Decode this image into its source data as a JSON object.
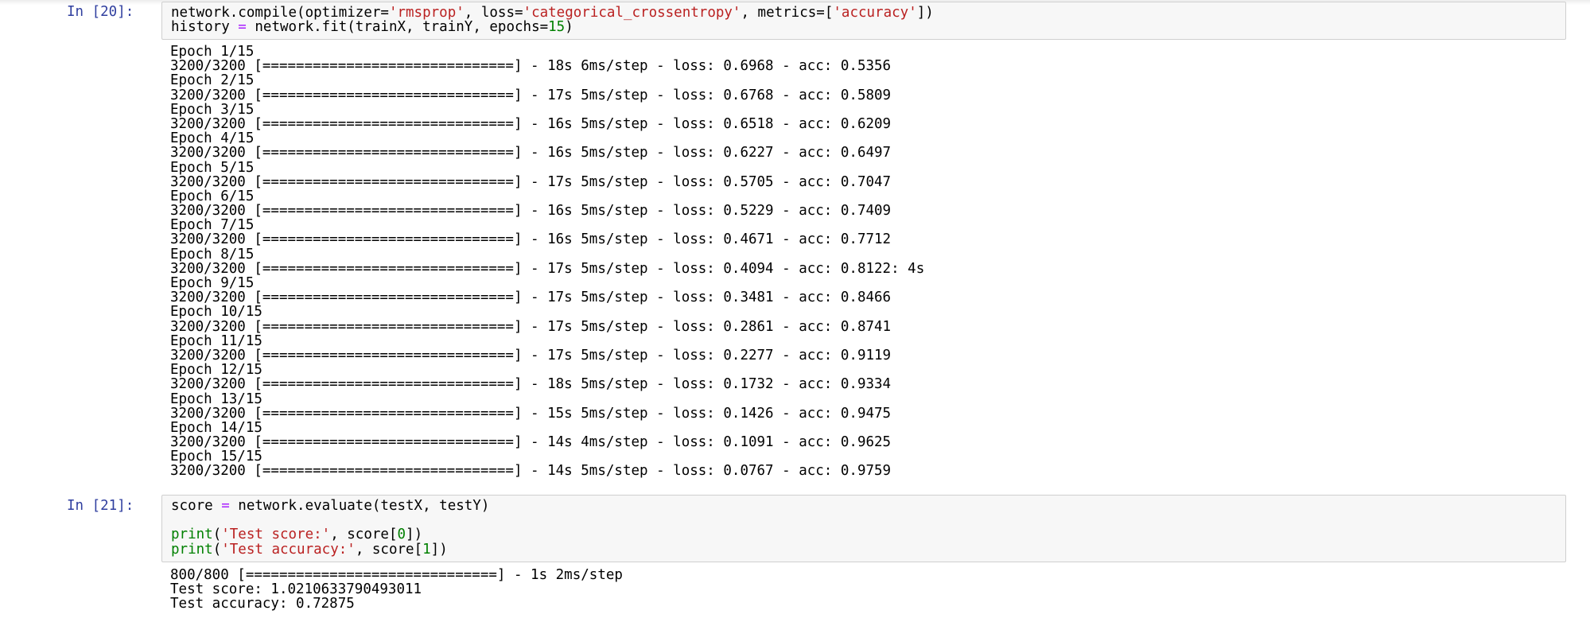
{
  "cells": [
    {
      "prompt": "In [20]:",
      "code": {
        "line1": {
          "a": "network.compile(optimizer=",
          "s1": "'rmsprop'",
          "b": ", loss=",
          "s2": "'categorical_crossentropy'",
          "c": ", metrics=[",
          "s3": "'accuracy'",
          "d": "])"
        },
        "line2": {
          "a": "history ",
          "op": "=",
          "b": " network.fit(trainX, trainY, epochs=",
          "n": "15",
          "c": ")"
        }
      },
      "output": [
        "Epoch 1/15",
        "3200/3200 [==============================] - 18s 6ms/step - loss: 0.6968 - acc: 0.5356",
        "Epoch 2/15",
        "3200/3200 [==============================] - 17s 5ms/step - loss: 0.6768 - acc: 0.5809",
        "Epoch 3/15",
        "3200/3200 [==============================] - 16s 5ms/step - loss: 0.6518 - acc: 0.6209",
        "Epoch 4/15",
        "3200/3200 [==============================] - 16s 5ms/step - loss: 0.6227 - acc: 0.6497",
        "Epoch 5/15",
        "3200/3200 [==============================] - 17s 5ms/step - loss: 0.5705 - acc: 0.7047",
        "Epoch 6/15",
        "3200/3200 [==============================] - 16s 5ms/step - loss: 0.5229 - acc: 0.7409",
        "Epoch 7/15",
        "3200/3200 [==============================] - 16s 5ms/step - loss: 0.4671 - acc: 0.7712",
        "Epoch 8/15",
        "3200/3200 [==============================] - 17s 5ms/step - loss: 0.4094 - acc: 0.8122: 4s",
        "Epoch 9/15",
        "3200/3200 [==============================] - 17s 5ms/step - loss: 0.3481 - acc: 0.8466",
        "Epoch 10/15",
        "3200/3200 [==============================] - 17s 5ms/step - loss: 0.2861 - acc: 0.8741",
        "Epoch 11/15",
        "3200/3200 [==============================] - 17s 5ms/step - loss: 0.2277 - acc: 0.9119",
        "Epoch 12/15",
        "3200/3200 [==============================] - 18s 5ms/step - loss: 0.1732 - acc: 0.9334",
        "Epoch 13/15",
        "3200/3200 [==============================] - 15s 5ms/step - loss: 0.1426 - acc: 0.9475",
        "Epoch 14/15",
        "3200/3200 [==============================] - 14s 4ms/step - loss: 0.1091 - acc: 0.9625",
        "Epoch 15/15",
        "3200/3200 [==============================] - 14s 5ms/step - loss: 0.0767 - acc: 0.9759"
      ]
    },
    {
      "prompt": "In [21]:",
      "code": {
        "line1": {
          "a": "score ",
          "op": "=",
          "b": " network.evaluate(testX, testY)"
        },
        "line3": {
          "kw": "print",
          "p1": "(",
          "s": "'Test score:'",
          "b": ", score[",
          "n": "0",
          "c": "])"
        },
        "line4": {
          "kw": "print",
          "p1": "(",
          "s": "'Test accuracy:'",
          "b": ", score[",
          "n": "1",
          "c": "])"
        }
      },
      "output": [
        "800/800 [==============================] - 1s 2ms/step",
        "Test score: 1.0210633790493011",
        "Test accuracy: 0.72875"
      ]
    }
  ],
  "colors": {
    "prompt": "#303f9f",
    "string": "#ba2121",
    "number": "#008000",
    "builtin": "#008000",
    "input_bg": "#f7f7f7",
    "input_border": "#cfcfcf"
  }
}
